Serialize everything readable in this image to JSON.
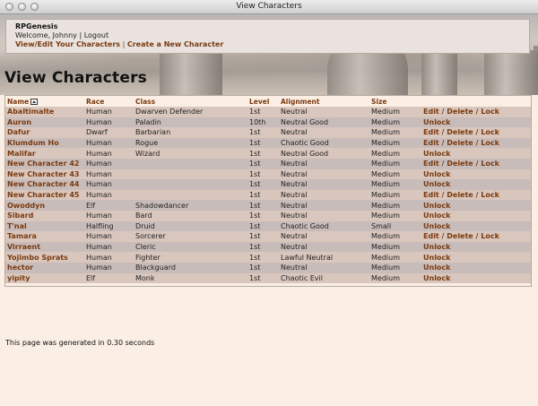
{
  "window": {
    "title": "View Characters"
  },
  "header": {
    "site_name": "RPGenesis",
    "welcome": "Welcome, Johnny",
    "separator": "|",
    "logout": "Logout",
    "nav_edit": "View/Edit Your Characters",
    "nav_sep": "|",
    "nav_new": "Create a New Character"
  },
  "page": {
    "heading": "View Characters"
  },
  "table": {
    "columns": {
      "name": "Name",
      "race": "Race",
      "class": "Class",
      "level": "Level",
      "alignment": "Alignment",
      "size": "Size"
    },
    "rows": [
      {
        "name": "Abaltimalte",
        "race": "Human",
        "class": "Dwarven Defender",
        "level": "1st",
        "alignment": "Neutral",
        "size": "Medium",
        "actions": "Edit / Delete / Lock"
      },
      {
        "name": "Auron",
        "race": "Human",
        "class": "Paladin",
        "level": "10th",
        "alignment": "Neutral Good",
        "size": "Medium",
        "actions": "Unlock"
      },
      {
        "name": "Dafur",
        "race": "Dwarf",
        "class": "Barbarian",
        "level": "1st",
        "alignment": "Neutral",
        "size": "Medium",
        "actions": "Edit / Delete / Lock"
      },
      {
        "name": "Klumdum Ho",
        "race": "Human",
        "class": "Rogue",
        "level": "1st",
        "alignment": "Chaotic Good",
        "size": "Medium",
        "actions": "Edit / Delete / Lock"
      },
      {
        "name": "Malifar",
        "race": "Human",
        "class": "Wizard",
        "level": "1st",
        "alignment": "Neutral Good",
        "size": "Medium",
        "actions": "Unlock"
      },
      {
        "name": "New Character 42",
        "race": "Human",
        "class": "",
        "level": "1st",
        "alignment": "Neutral",
        "size": "Medium",
        "actions": "Edit / Delete / Lock"
      },
      {
        "name": "New Character 43",
        "race": "Human",
        "class": "",
        "level": "1st",
        "alignment": "Neutral",
        "size": "Medium",
        "actions": "Unlock"
      },
      {
        "name": "New Character 44",
        "race": "Human",
        "class": "",
        "level": "1st",
        "alignment": "Neutral",
        "size": "Medium",
        "actions": "Unlock"
      },
      {
        "name": "New Character 45",
        "race": "Human",
        "class": "",
        "level": "1st",
        "alignment": "Neutral",
        "size": "Medium",
        "actions": "Edit / Delete / Lock"
      },
      {
        "name": "Owoddyn",
        "race": "Elf",
        "class": "Shadowdancer",
        "level": "1st",
        "alignment": "Neutral",
        "size": "Medium",
        "actions": "Unlock"
      },
      {
        "name": "Sibard",
        "race": "Human",
        "class": "Bard",
        "level": "1st",
        "alignment": "Neutral",
        "size": "Medium",
        "actions": "Unlock"
      },
      {
        "name": "T'nal",
        "race": "Halfling",
        "class": "Druid",
        "level": "1st",
        "alignment": "Chaotic Good",
        "size": "Small",
        "actions": "Unlock"
      },
      {
        "name": "Tamara",
        "race": "Human",
        "class": "Sorcerer",
        "level": "1st",
        "alignment": "Neutral",
        "size": "Medium",
        "actions": "Edit / Delete / Lock"
      },
      {
        "name": "Virraent",
        "race": "Human",
        "class": "Cleric",
        "level": "1st",
        "alignment": "Neutral",
        "size": "Medium",
        "actions": "Unlock"
      },
      {
        "name": "Yojimbo Sprats",
        "race": "Human",
        "class": "Fighter",
        "level": "1st",
        "alignment": "Lawful Neutral",
        "size": "Medium",
        "actions": "Unlock"
      },
      {
        "name": "hector",
        "race": "Human",
        "class": "Blackguard",
        "level": "1st",
        "alignment": "Neutral",
        "size": "Medium",
        "actions": "Unlock"
      },
      {
        "name": "yipity",
        "race": "Elf",
        "class": "Monk",
        "level": "1st",
        "alignment": "Chaotic Evil",
        "size": "Medium",
        "actions": "Unlock"
      }
    ]
  },
  "footer": {
    "generated": "This page was generated in 0.30 seconds"
  },
  "colors": {
    "link": "#7a3b10",
    "row_odd": "#d9c6bd",
    "row_even": "#c8bcba",
    "background": "#fbeee4"
  }
}
